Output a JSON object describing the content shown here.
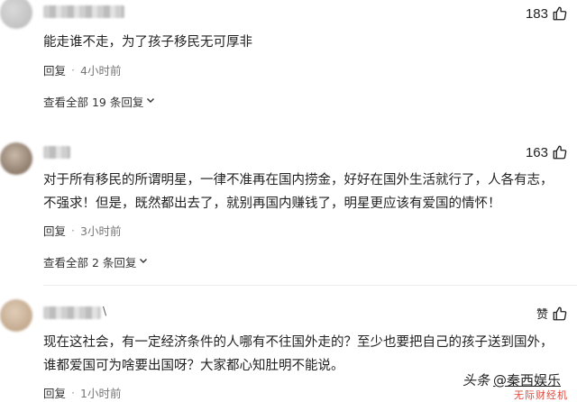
{
  "comments": [
    {
      "username_tail": "",
      "likes": "183",
      "text": "能走谁不走，为了孩子移民无可厚非",
      "reply_label": "回复",
      "time": "4小时前",
      "view_all": "查看全部 19 条回复"
    },
    {
      "username_tail": "",
      "likes": "163",
      "text": "对于所有移民的所谓明星，一律不准再在国内捞金，好好在国外生活就行了，人各有志，不强求！但是，既然都出去了，就别再国内赚钱了，明星更应该有爱国的情怀！",
      "reply_label": "回复",
      "time": "3小时前",
      "view_all": "查看全部 2 条回复"
    },
    {
      "username_tail": "\\",
      "likes": "赞",
      "text": "现在这社会，有一定经济条件的人哪有不往国外走的？至少也要把自己的孩子送到国外，谁都爱国可为啥要出国呀？大家都心知肚明不能说。",
      "reply_label": "回复",
      "time": "1小时前",
      "view_all": ""
    }
  ],
  "watermark": {
    "brand": "头条",
    "account": "@秦西娱乐",
    "sub": "无际财经机"
  },
  "icons": {
    "like": "thumbs-up-icon",
    "expand": "chevron-down-icon"
  }
}
